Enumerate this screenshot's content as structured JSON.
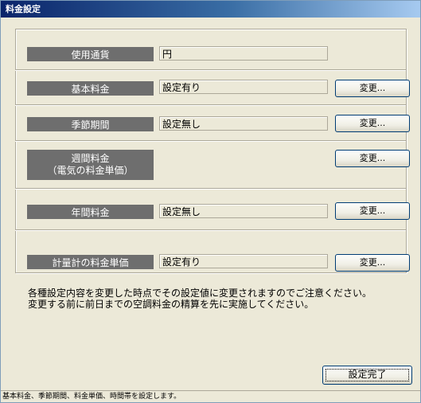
{
  "window": {
    "title": "料金設定"
  },
  "settings": [
    {
      "label": "使用通貨",
      "value": "円",
      "button": null
    },
    {
      "label": "基本料金",
      "value": "設定有り",
      "button": "変更..."
    },
    {
      "label": "季節期間",
      "value": "設定無し",
      "button": "変更..."
    },
    {
      "label": "週間料金",
      "label2": "（電気の料金単価）",
      "value": null,
      "button": "変更..."
    },
    {
      "label": "年間料金",
      "value": "設定無し",
      "button": "変更..."
    },
    {
      "label": "計量計の料金単価",
      "value": "設定有り",
      "button": "変更..."
    }
  ],
  "notice": {
    "line1": "各種設定内容を変更した時点でその設定値に変更されますのでご注意ください。",
    "line2": "変更する前に前日までの空調料金の精算を先に実施してください。"
  },
  "done_button": "設定完了",
  "status_bar": "基本料金、季節期間、料金単価、時間帯を設定します。"
}
